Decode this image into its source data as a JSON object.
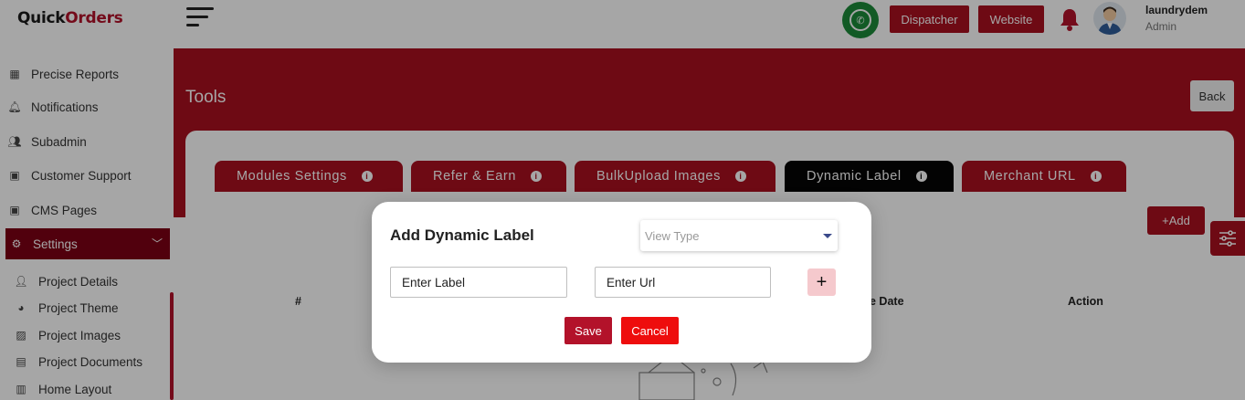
{
  "app": {
    "logo_main": "Quick",
    "logo_accent": "Orders"
  },
  "sidebar": {
    "items": [
      {
        "label": "Precise Reports",
        "icon": "report-icon"
      },
      {
        "label": "Notifications",
        "icon": "bell-icon"
      },
      {
        "label": "Subadmin",
        "icon": "users-icon"
      },
      {
        "label": "Customer Support",
        "icon": "chat-icon"
      },
      {
        "label": "CMS Pages",
        "icon": "comment-icon"
      },
      {
        "label": "Settings",
        "icon": "gear-icon",
        "active": true
      }
    ],
    "sub_items": [
      {
        "label": "Project Details",
        "icon": "user-gear-icon"
      },
      {
        "label": "Project Theme",
        "icon": "palette-icon"
      },
      {
        "label": "Project Images",
        "icon": "image-icon"
      },
      {
        "label": "Project Documents",
        "icon": "document-icon"
      },
      {
        "label": "Home Layout",
        "icon": "layout-icon"
      }
    ]
  },
  "header": {
    "dispatcher_label": "Dispatcher",
    "website_label": "Website",
    "user_name": "laundrydem",
    "user_role": "Admin"
  },
  "page": {
    "title": "Tools",
    "back_label": "Back",
    "add_label": "+Add",
    "tabs": [
      {
        "label": "Modules Settings"
      },
      {
        "label": "Refer & Earn"
      },
      {
        "label": "BulkUpload Images"
      },
      {
        "label": "Dynamic Label",
        "active": true
      },
      {
        "label": "Merchant URL"
      }
    ],
    "table_headers": [
      "#",
      "e Date",
      "Action"
    ]
  },
  "modal": {
    "title": "Add Dynamic Label",
    "view_type_placeholder": "View Type",
    "label_placeholder": "Enter Label",
    "url_placeholder": "Enter Url",
    "save_label": "Save",
    "cancel_label": "Cancel"
  },
  "colors": {
    "brand": "#a9101f",
    "active_tab": "#050505",
    "cancel": "#ee0d0d",
    "whatsapp": "#1d8a3a"
  }
}
